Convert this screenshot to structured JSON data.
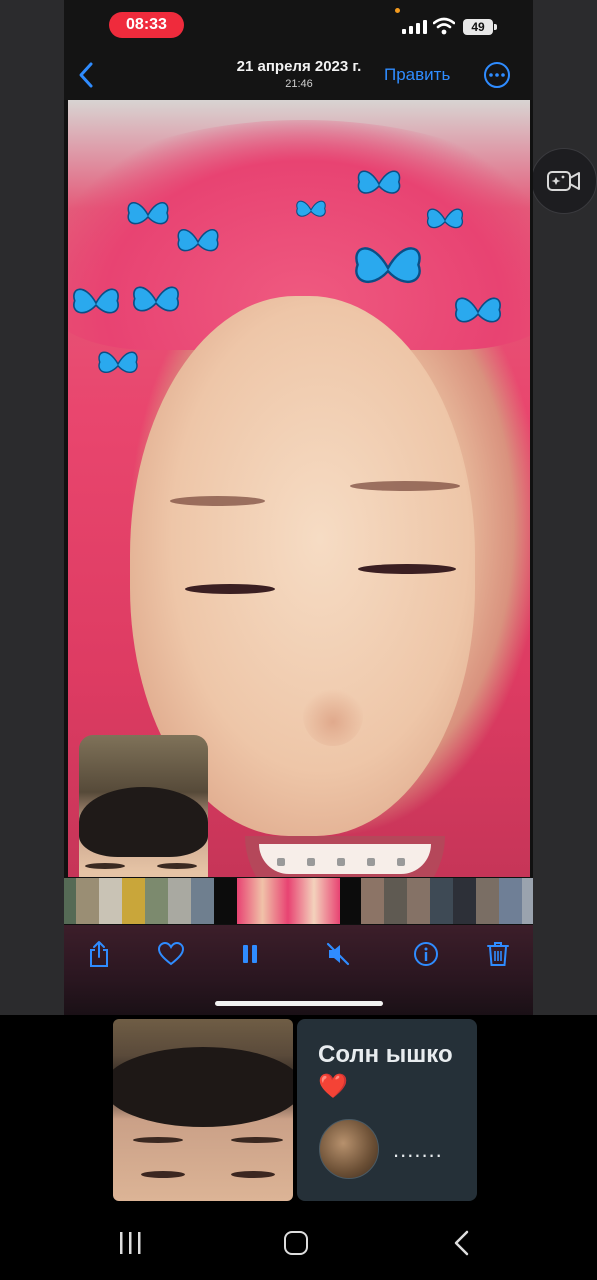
{
  "status_bar": {
    "time": "08:33",
    "battery": "49"
  },
  "nav": {
    "title": "21 апреля 2023 г.",
    "subtitle": "21:46",
    "edit_label": "Править"
  },
  "colors": {
    "accent": "#2f8cff",
    "time_pill": "#ef2b3c"
  },
  "toolbar": {
    "icons": [
      "share-icon",
      "heart-icon",
      "pause-icon",
      "mute-icon",
      "info-icon",
      "trash-icon"
    ]
  },
  "notification": {
    "title": "Солн ышко ❤️",
    "preview": "......."
  }
}
